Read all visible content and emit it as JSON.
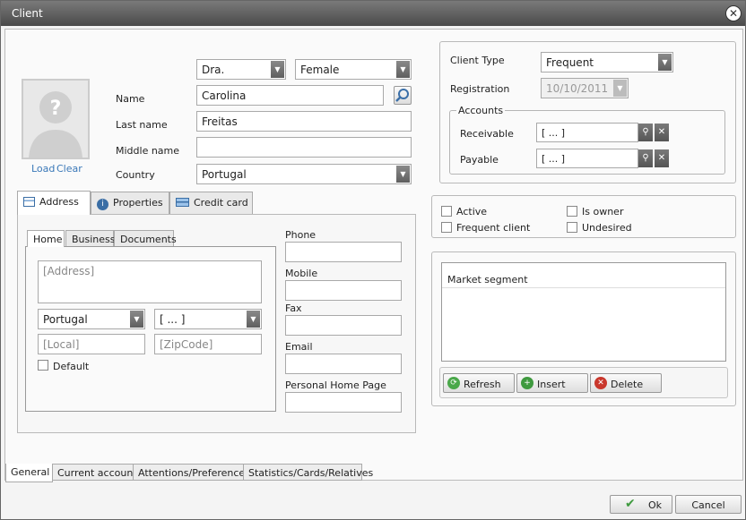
{
  "window": {
    "title": "Client"
  },
  "client": {
    "title": "Dra.",
    "gender": "Female",
    "name_label": "Name",
    "name": "Carolina",
    "last_name_label": "Last name",
    "last_name": "Freitas",
    "middle_name_label": "Middle name",
    "middle_name": "",
    "country_label": "Country",
    "country": "Portugal",
    "photo_load": "Load",
    "photo_clear": "Clear"
  },
  "client_type": {
    "label": "Client Type",
    "value": "Frequent",
    "registration_label": "Registration",
    "registration": "10/10/2011",
    "accounts_legend": "Accounts",
    "receivable_label": "Receivable",
    "receivable": "[ ... ]",
    "payable_label": "Payable",
    "payable": "[ ... ]"
  },
  "flags": {
    "active": "Active",
    "frequent": "Frequent client",
    "owner": "Is owner",
    "undesired": "Undesired"
  },
  "market": {
    "header": "Market segment",
    "refresh": "Refresh",
    "insert": "Insert",
    "delete": "Delete"
  },
  "info_tabs": [
    "Address",
    "Properties",
    "Credit card"
  ],
  "address_tabs": [
    "Home",
    "Business",
    "Documents"
  ],
  "address": {
    "address_placeholder": "[Address]",
    "country": "Portugal",
    "region": "[ ... ]",
    "local_placeholder": "[Local]",
    "zip_placeholder": "[ZipCode]",
    "default_label": "Default"
  },
  "contact": {
    "phone": "Phone",
    "mobile": "Mobile",
    "fax": "Fax",
    "email": "Email",
    "homepage": "Personal Home Page"
  },
  "bottom_tabs": [
    "General",
    "Current account",
    "Attentions/Preferences",
    "Statistics/Cards/Relatives"
  ],
  "footer": {
    "ok": "Ok",
    "cancel": "Cancel"
  }
}
